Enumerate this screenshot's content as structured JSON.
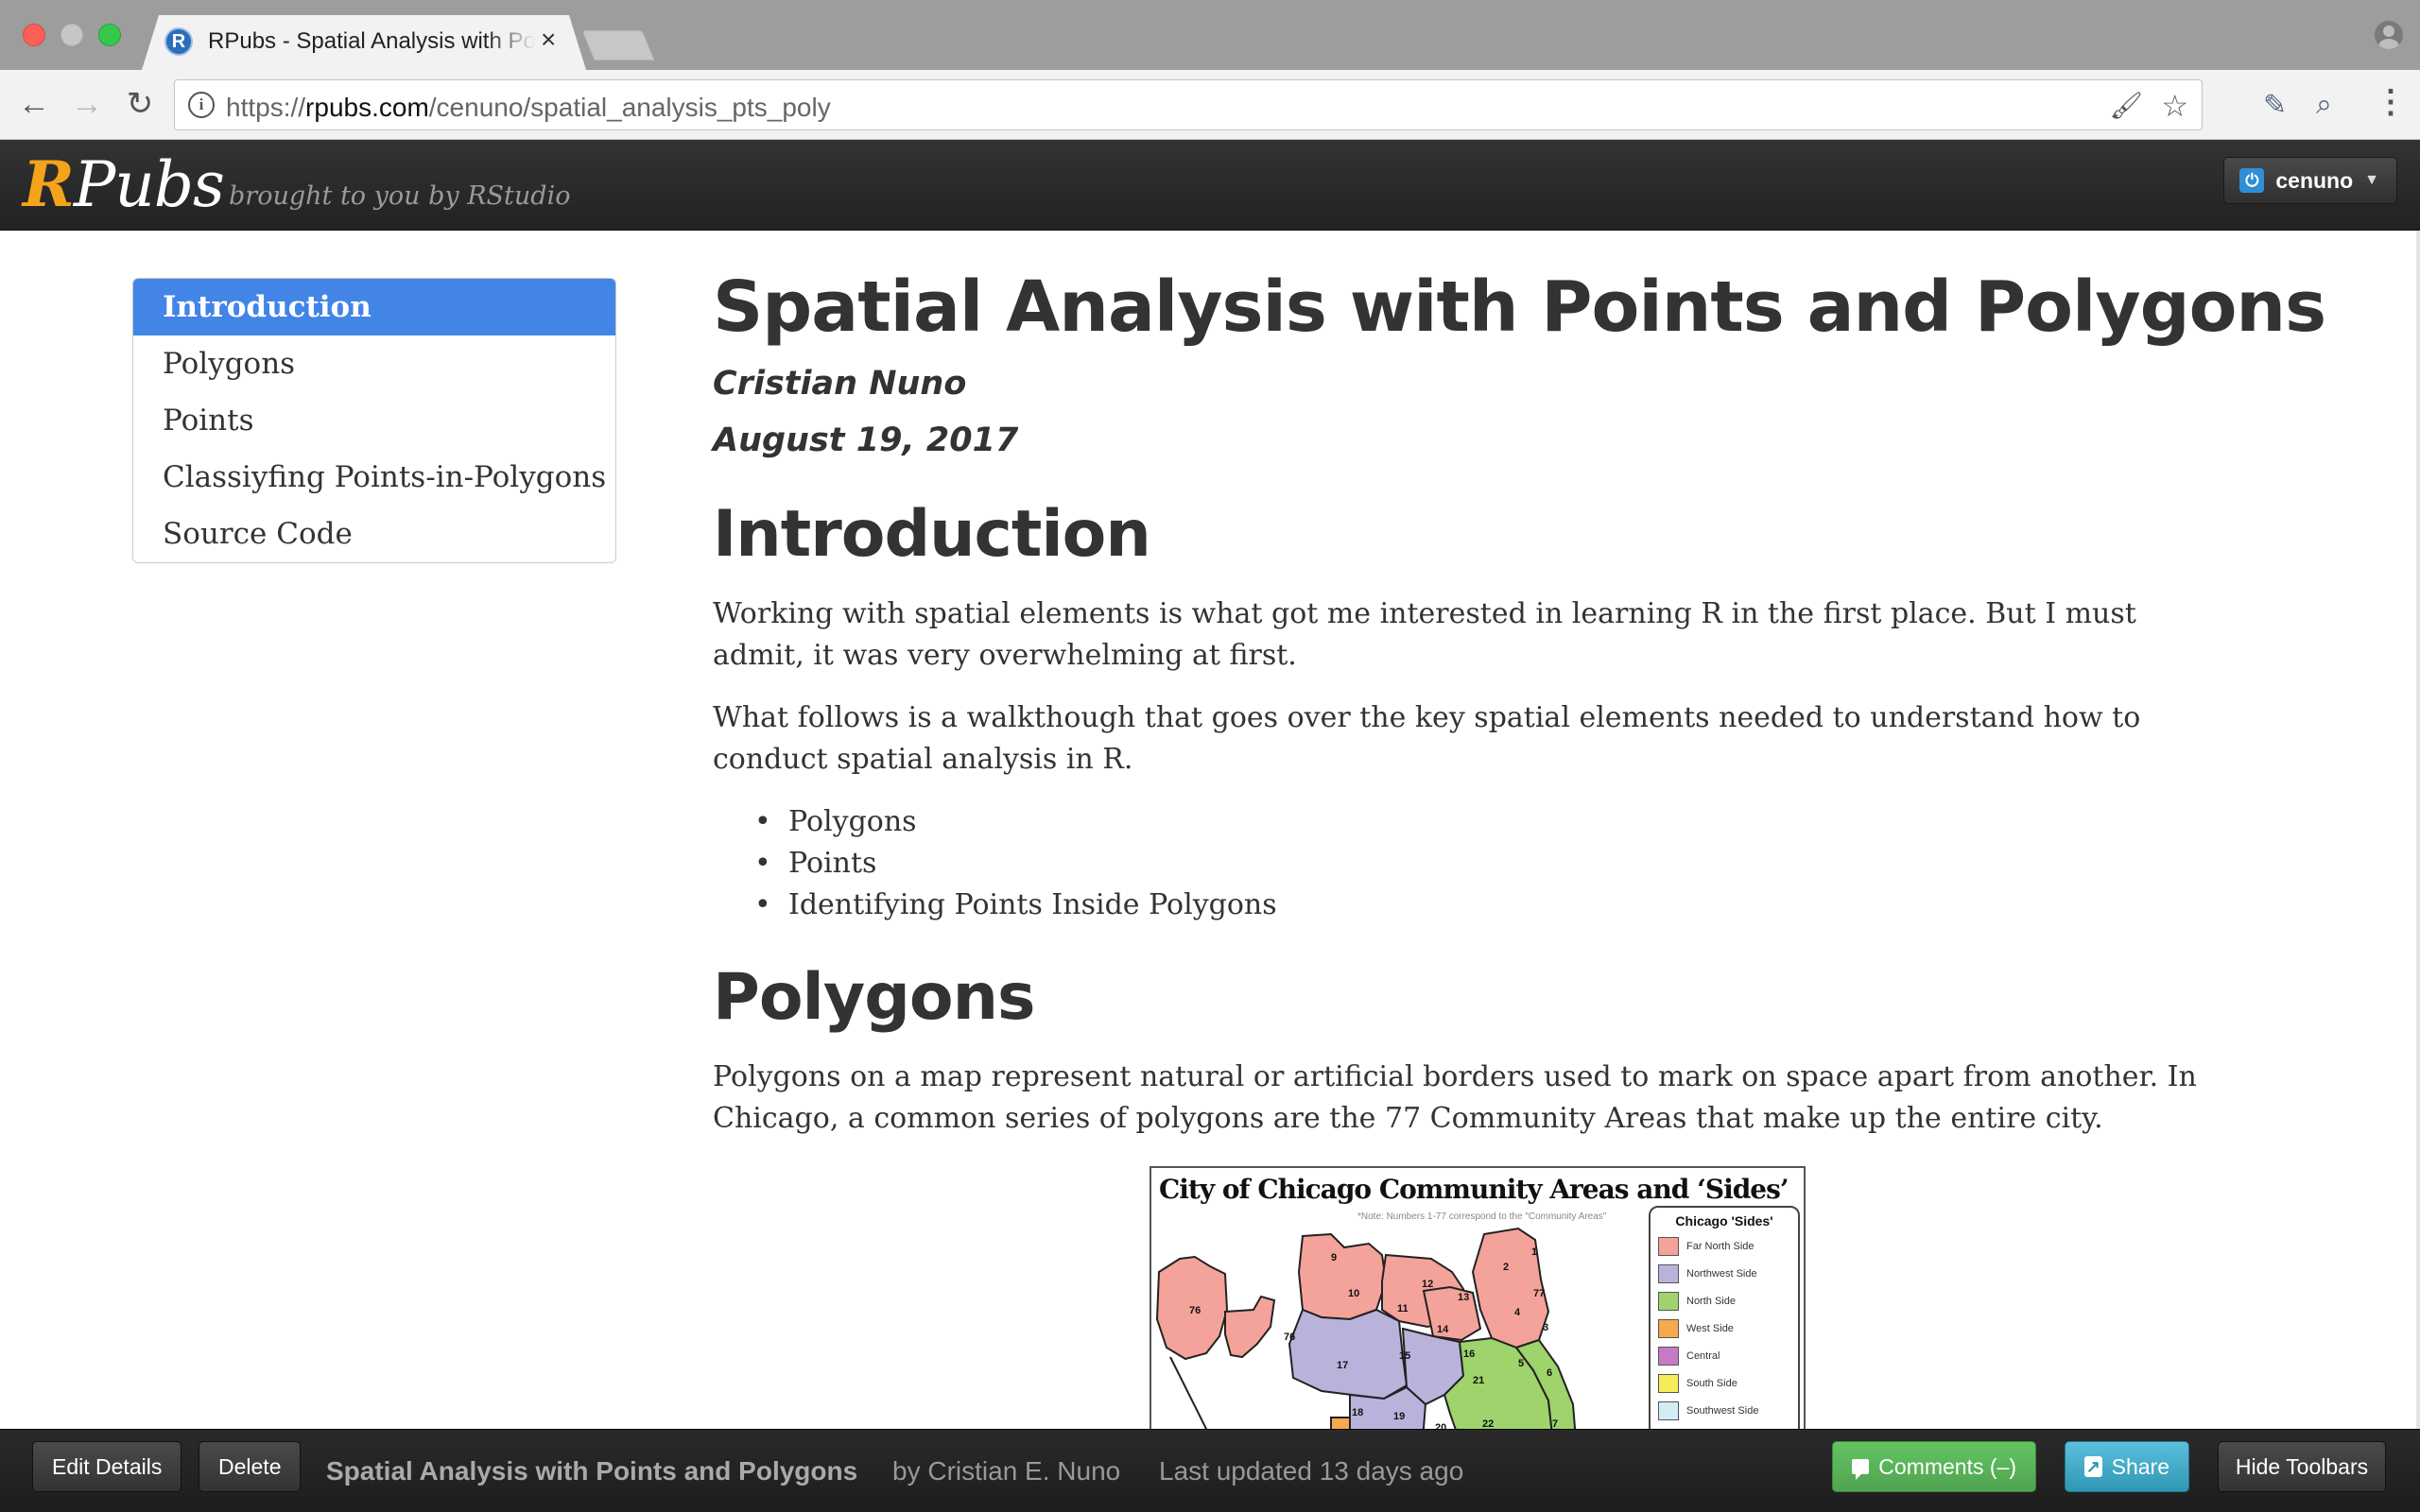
{
  "browser": {
    "tab_title": "RPubs - Spatial Analysis with Points and Polygons",
    "tab_favicon": "R",
    "tab_close": "×",
    "url_scheme": "https://",
    "url_host": "rpubs.com",
    "url_path": "/cenuno/spatial_analysis_pts_poly",
    "icons": {
      "back": "←",
      "forward": "→",
      "reload": "↻",
      "info": "i",
      "star": "☆",
      "brush": "🖌",
      "menu": "⋮",
      "ext1": "✎",
      "ext2": "⌕"
    }
  },
  "site": {
    "logo_r": "R",
    "logo_rest": "Pubs",
    "tagline": "brought to you by RStudio",
    "user": "cenuno",
    "power_icon": "⏻",
    "caret": "▼"
  },
  "toc": {
    "items": [
      {
        "label": "Introduction",
        "active": true
      },
      {
        "label": "Polygons",
        "active": false
      },
      {
        "label": "Points",
        "active": false
      },
      {
        "label": "Classiyfing Points-in-Polygons",
        "active": false
      },
      {
        "label": "Source Code",
        "active": false
      }
    ]
  },
  "article": {
    "title": "Spatial Analysis with Points and Polygons",
    "author": "Cristian Nuno",
    "date": "August 19, 2017",
    "intro_heading": "Introduction",
    "intro_p1": "Working with spatial elements is what got me interested in learning R in the first place. But I must admit, it was very overwhelming at first.",
    "intro_p2": "What follows is a walkthough that goes over the key spatial elements needed to understand how to conduct spatial analysis in R.",
    "bullets": [
      "Polygons",
      "Points",
      "Identifying Points Inside Polygons"
    ],
    "polygons_heading": "Polygons",
    "polygons_p1": "Polygons on a map represent natural or artificial borders used to mark on space apart from another. In Chicago, a common series of polygons are the 77 Community Areas that make up the entire city."
  },
  "map": {
    "title": "City of Chicago Community Areas and ‘Sides’",
    "note": "*Note: Numbers 1-77 correspond to the \"Community Areas\"",
    "legend_title": "Chicago 'Sides'",
    "legend": [
      {
        "label": "Far North Side",
        "color": "#f4a39a"
      },
      {
        "label": "Northwest Side",
        "color": "#b9b3dc"
      },
      {
        "label": "North Side",
        "color": "#9fd36b"
      },
      {
        "label": "West Side",
        "color": "#f6a94e"
      },
      {
        "label": "Central",
        "color": "#c67ac6"
      },
      {
        "label": "South Side",
        "color": "#f6ec5a"
      },
      {
        "label": "Southwest Side",
        "color": "#d4ecf6"
      }
    ],
    "area_numbers": [
      "76",
      "9",
      "10",
      "11",
      "12",
      "13",
      "2",
      "1",
      "77",
      "4",
      "3",
      "76",
      "17",
      "15",
      "16",
      "14",
      "5",
      "6",
      "21",
      "18",
      "19",
      "20",
      "22",
      "7"
    ]
  },
  "bottom_bar": {
    "edit": "Edit Details",
    "delete": "Delete",
    "doc_title": "Spatial Analysis with Points and Polygons",
    "by": "by Cristian E. Nuno",
    "updated": "Last updated 13 days ago",
    "comments": "Comments (–)",
    "share": "Share",
    "hide": "Hide Toolbars"
  }
}
